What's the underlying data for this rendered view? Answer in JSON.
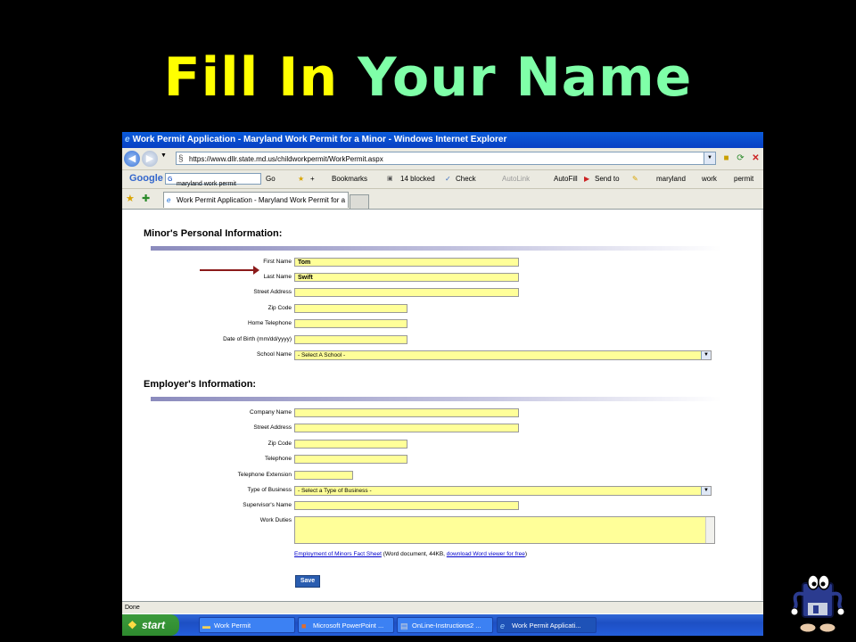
{
  "slide": {
    "title_part1": "Fill In",
    "title_part2": "Your Name"
  },
  "window": {
    "title": "Work Permit Application - Maryland Work Permit for a Minor - Windows Internet Explorer"
  },
  "address_bar": {
    "url": "https://www.dllr.state.md.us/childworkpermit/WorkPermit.aspx"
  },
  "google_toolbar": {
    "logo": "Google",
    "search_value": "maryland work permit",
    "go": "Go",
    "bookmarks": "Bookmarks",
    "blocked": "14 blocked",
    "check": "Check",
    "autolink": "AutoLink",
    "autofill": "AutoFill",
    "send_to": "Send to",
    "terms": [
      "maryland",
      "work",
      "permit"
    ]
  },
  "tab": {
    "label": "Work Permit Application - Maryland Work Permit for a ..."
  },
  "form": {
    "minor_heading": "Minor's Personal Information:",
    "minor_fields": [
      {
        "label": "First Name",
        "value": "Tom"
      },
      {
        "label": "Last Name",
        "value": "Swift"
      },
      {
        "label": "Street Address",
        "value": ""
      },
      {
        "label": "Zip Code",
        "value": ""
      },
      {
        "label": "Home Telephone",
        "value": ""
      },
      {
        "label": "Date of Birth (mm/dd/yyyy)",
        "value": ""
      }
    ],
    "school_label": "School Name",
    "school_value": "- Select A School -",
    "employer_heading": "Employer's Information:",
    "employer_fields": [
      {
        "label": "Company Name",
        "value": ""
      },
      {
        "label": "Street Address",
        "value": ""
      },
      {
        "label": "Zip Code",
        "value": ""
      },
      {
        "label": "Telephone",
        "value": ""
      },
      {
        "label": "Telephone Extension",
        "value": ""
      }
    ],
    "business_label": "Type of Business",
    "business_value": "- Select a Type of Business -",
    "supervisor_label": "Supervisor's Name",
    "supervisor_value": "",
    "duties_label": "Work Duties",
    "fact_sheet_link": "Employment of Minors Fact Sheet",
    "fact_sheet_note": "(Word document, 44KB,",
    "viewer_link": "download Word viewer for free",
    "fact_sheet_close": ")",
    "save_label": "Save"
  },
  "status": {
    "text": "Done"
  },
  "taskbar": {
    "start": "start",
    "items": [
      "Work Permit",
      "Microsoft PowerPoint ...",
      "OnLine-Instructions2 ...",
      "Work Permit Applicati..."
    ]
  },
  "colors": {
    "title_yellow": "#ffff00",
    "title_green": "#7fffa8",
    "field_yellow": "#ffff99",
    "arrow": "#8b1a1a"
  }
}
